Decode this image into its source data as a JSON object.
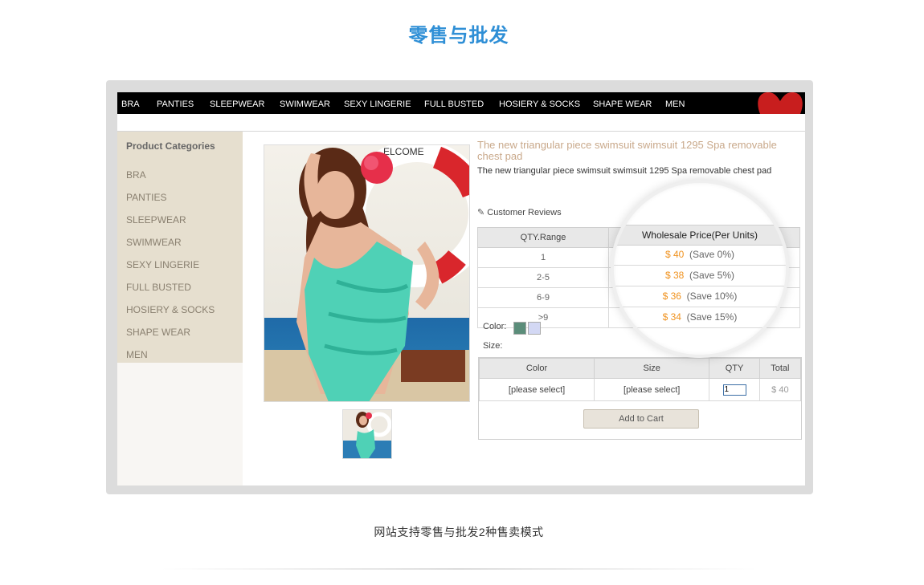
{
  "heading": "零售与批发",
  "caption": "网站支持零售与批发2种售卖模式",
  "nav": {
    "items": [
      "BRA",
      "PANTIES",
      "SLEEPWEAR",
      "SWIMWEAR",
      "SEXY LINGERIE",
      "FULL BUSTED",
      "HOSIERY & SOCKS",
      "SHAPE WEAR",
      "MEN"
    ]
  },
  "sidebar": {
    "heading": "Product Categories",
    "items": [
      "BRA",
      "PANTIES",
      "SLEEPWEAR",
      "SWIMWEAR",
      "SEXY LINGERIE",
      "FULL BUSTED",
      "HOSIERY & SOCKS",
      "SHAPE WEAR",
      "MEN"
    ]
  },
  "product": {
    "title": "The new triangular piece swimsuit swimsuit 1295 Spa removable chest pad",
    "subtitle": "The new triangular piece swimsuit swimsuit 1295 Spa removable chest pad",
    "reviews_link": "Customer Reviews",
    "image_sign_text": "ELCOME"
  },
  "pricing": {
    "col_qty": "QTY.Range",
    "col_price": "Wholesale Price(Per Units)",
    "rows": [
      {
        "range": "1",
        "price": "$ 40",
        "save": "(Save 0%)"
      },
      {
        "range": "2-5",
        "price": "$ 38",
        "save": "(Save 5%)"
      },
      {
        "range": "6-9",
        "price": "$ 36",
        "save": "(Save 10%)"
      },
      {
        "range": ">9",
        "price": "$ 34",
        "save": "(Save 15%)"
      }
    ]
  },
  "options": {
    "color_label": "Color:",
    "size_label": "Size:",
    "swatches": [
      "#5b8d7a",
      "#d3d8f4"
    ]
  },
  "order": {
    "headers": [
      "Color",
      "Size",
      "QTY",
      "Total"
    ],
    "color_value": "[please select]",
    "size_value": "[please select]",
    "qty_value": "1",
    "total": "$ 40",
    "add_to_cart": "Add to Cart"
  },
  "colors": {
    "accent": "#2f8fd6",
    "price": "#f0921e",
    "sidebar_bg": "#e6dfcf",
    "nav_bg": "#000000"
  }
}
